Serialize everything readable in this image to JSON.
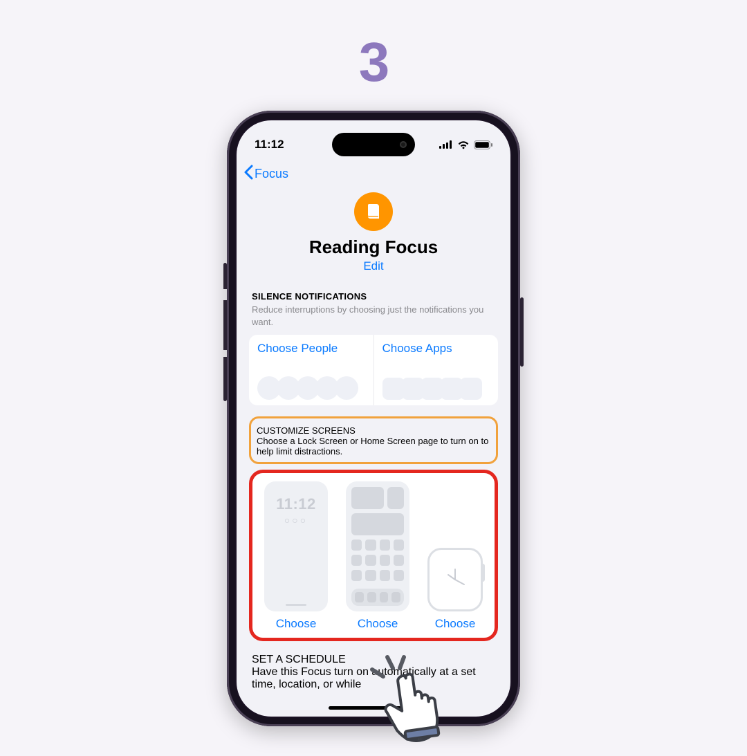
{
  "step_number": "3",
  "status": {
    "time": "11:12"
  },
  "nav": {
    "back_label": "Focus"
  },
  "header": {
    "title": "Reading Focus",
    "edit_label": "Edit"
  },
  "silence": {
    "heading": "SILENCE NOTIFICATIONS",
    "description": "Reduce interruptions by choosing just the notifications you want.",
    "choose_people": "Choose People",
    "choose_apps": "Choose Apps"
  },
  "customize": {
    "heading": "CUSTOMIZE SCREENS",
    "description": "Choose a Lock Screen or Home Screen page to turn on to help limit distractions.",
    "lock_preview_time": "11:12",
    "choose_lock": "Choose",
    "choose_home": "Choose",
    "choose_watch": "Choose"
  },
  "schedule": {
    "heading": "SET A SCHEDULE",
    "description_visible": "Have this Focus turn on automatically at a set time, location, or while"
  }
}
